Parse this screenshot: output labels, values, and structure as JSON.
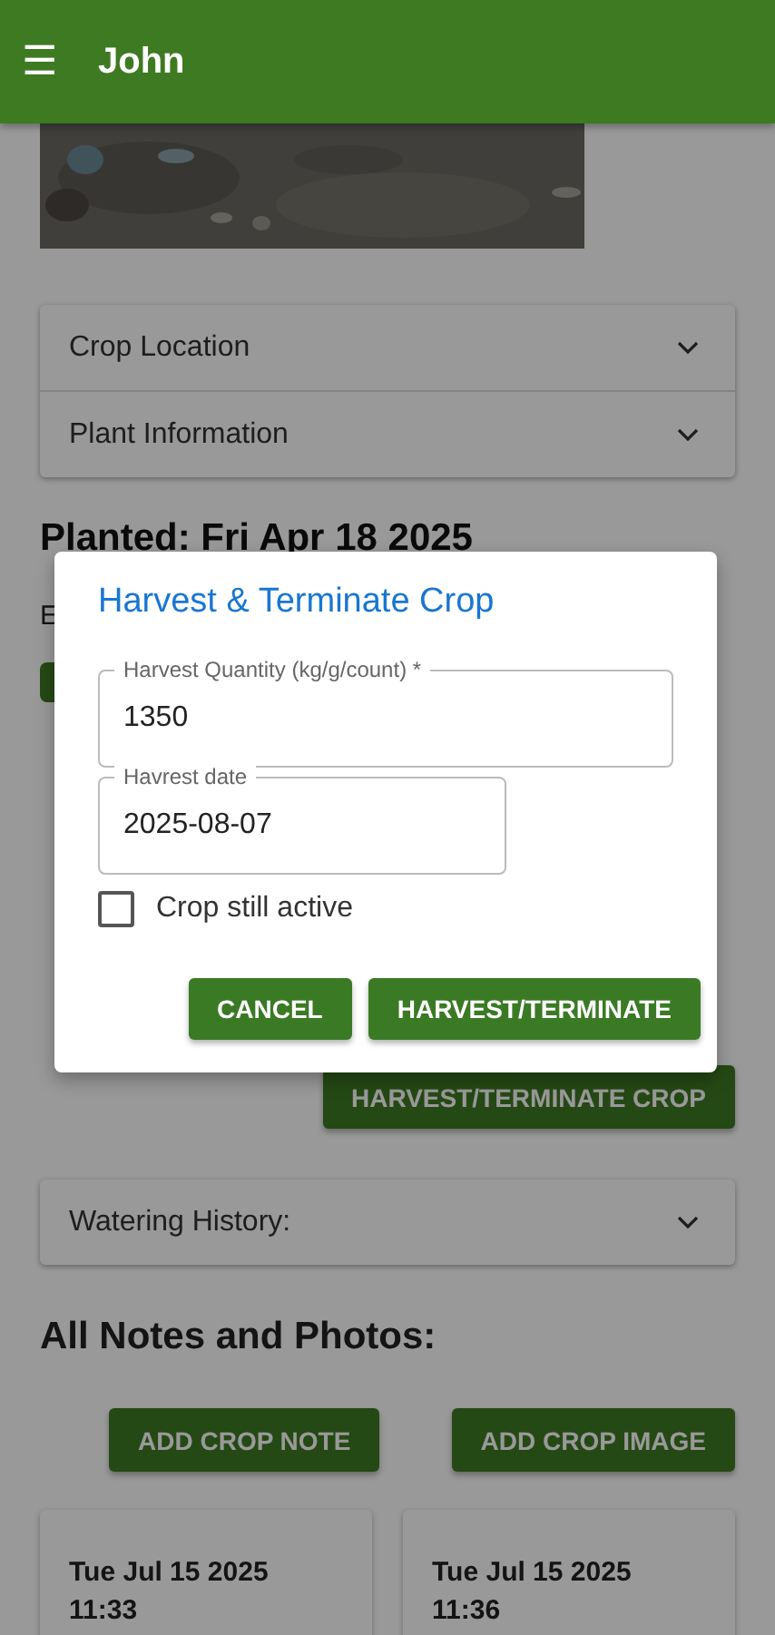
{
  "app_bar": {
    "menu_icon": "☰",
    "title": "John"
  },
  "info_panels": [
    {
      "label": "Crop Location",
      "expanded": false
    },
    {
      "label": "Plant Information",
      "expanded": false
    }
  ],
  "planted_heading": "Planted: Fri Apr 18 2025",
  "covered_texts": [
    {
      "kind": "text",
      "text": "E"
    }
  ],
  "harvest_button": "HARVEST/TERMINATE CROP",
  "watering_panel": {
    "label": "Watering History:",
    "expanded": false
  },
  "notes_heading": "All Notes and Photos:",
  "note_buttons": [
    "ADD CROP NOTE",
    "ADD CROP IMAGE"
  ],
  "notes": [
    {
      "date": "Tue Jul 15 2025",
      "time": "11:33"
    },
    {
      "date": "Tue Jul 15 2025",
      "time": "11:36"
    }
  ],
  "dialog": {
    "title": "Harvest & Terminate Crop",
    "fields": [
      {
        "label": "Harvest Quantity (kg/g/count) *",
        "value": "1350",
        "wide": true
      },
      {
        "label": "Havrest date",
        "value": "2025-08-07",
        "wide": false
      }
    ],
    "checkbox": {
      "label": "Crop still active",
      "checked": false
    },
    "buttons": [
      "CANCEL",
      "HARVEST/TERMINATE"
    ]
  }
}
